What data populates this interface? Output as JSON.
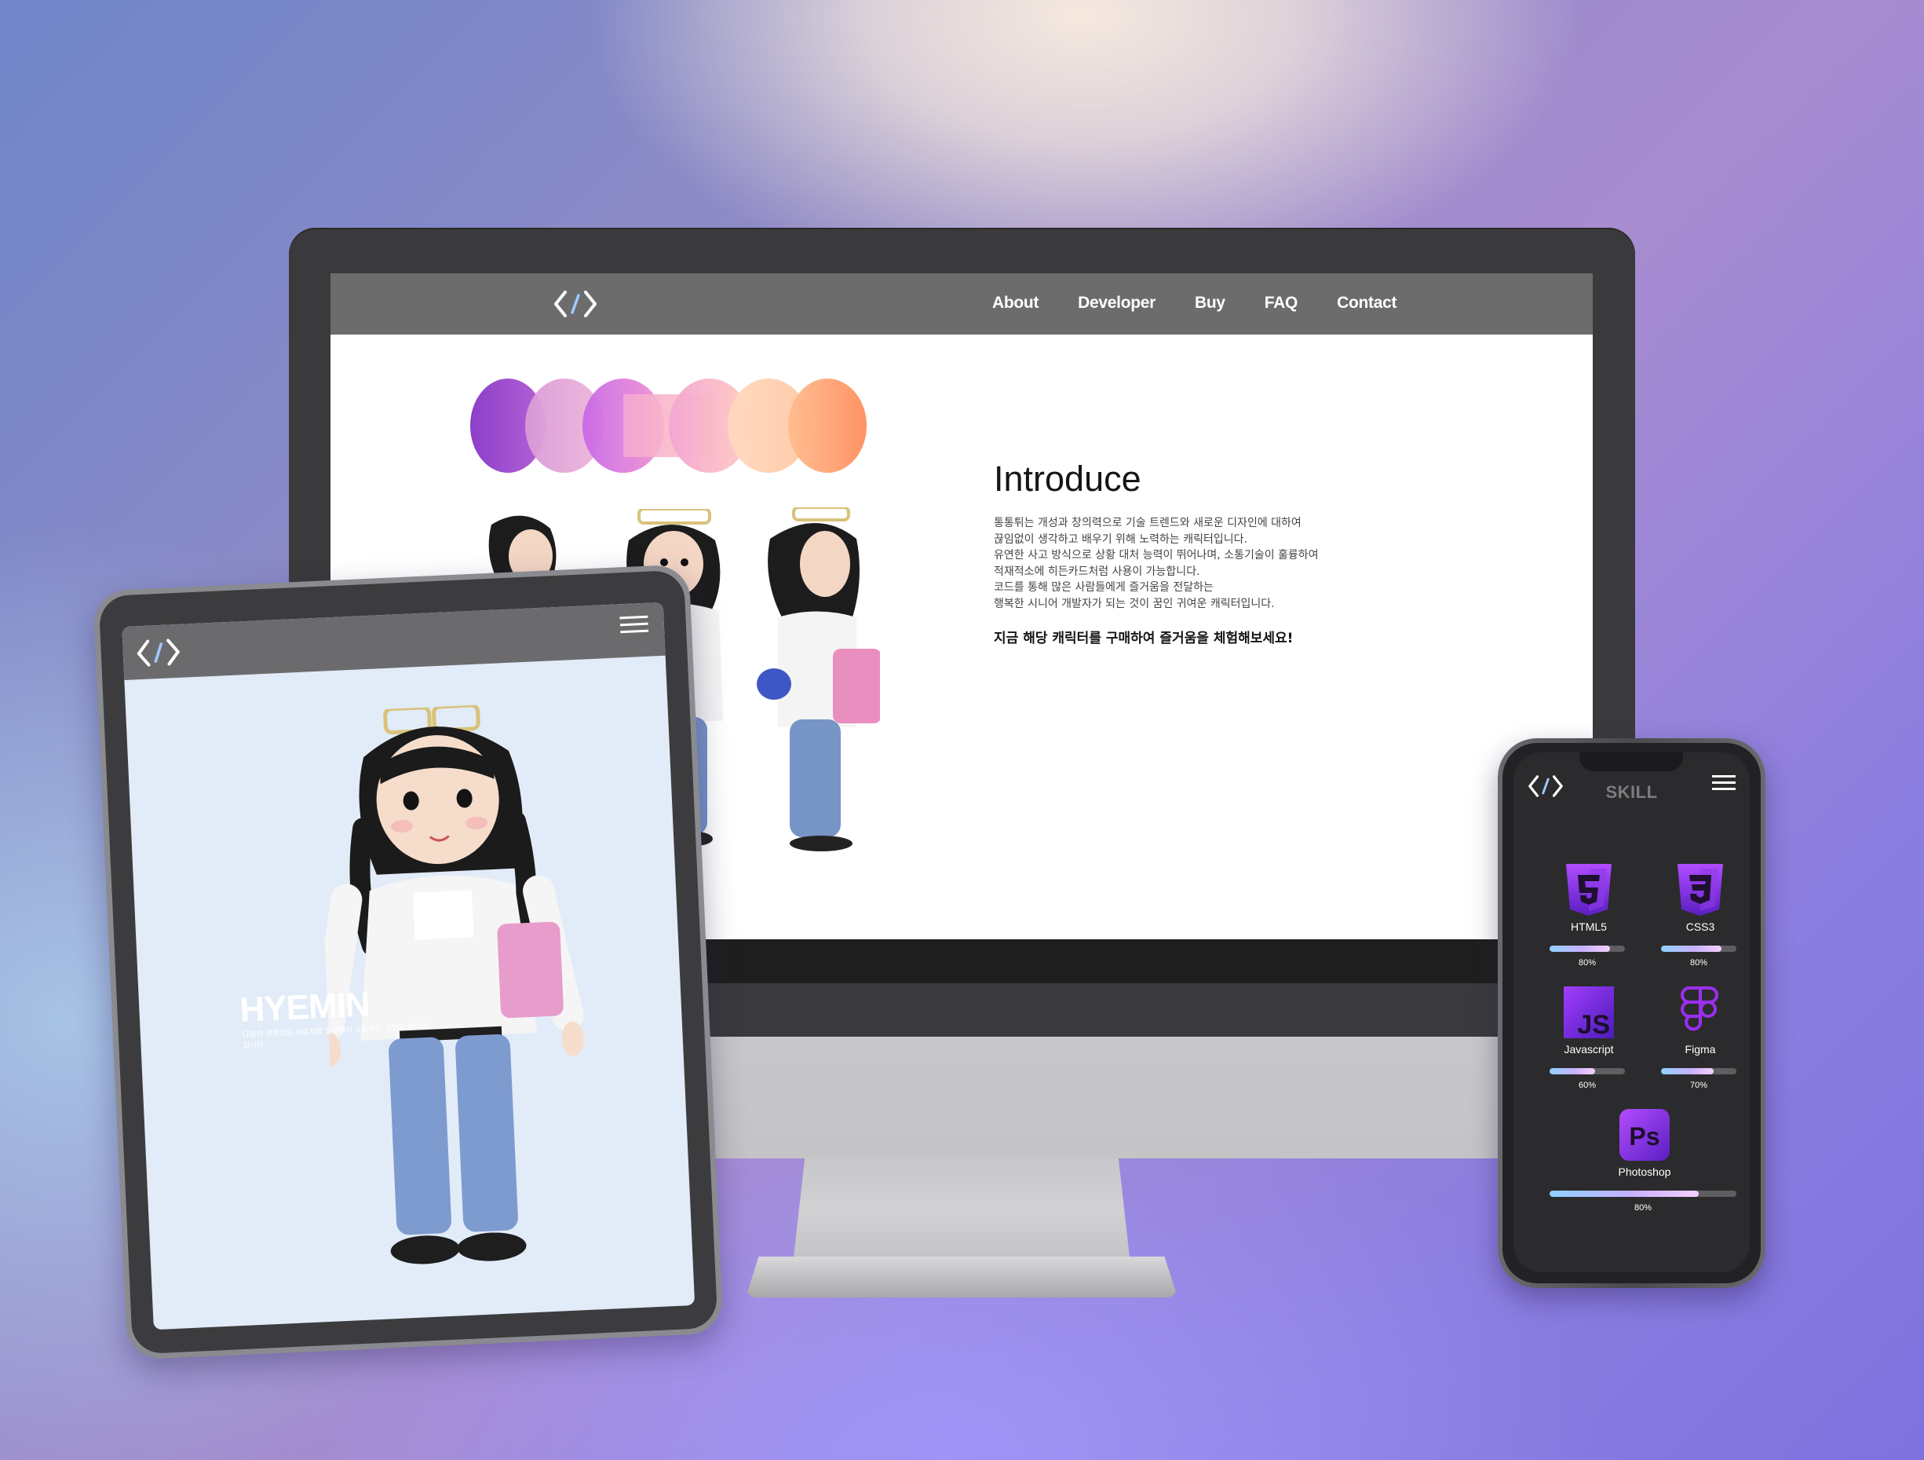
{
  "desktop": {
    "nav": {
      "logo_icon": "code-brackets-icon",
      "items": [
        "About",
        "Developer",
        "Buy",
        "FAQ",
        "Contact"
      ]
    },
    "intro": {
      "title": "Introduce",
      "body_lines": [
        "통통튀는 개성과 창의력으로 기술 트렌드와 새로운 디자인에 대하여",
        "끊임없이 생각하고 배우기 위해 노력하는 캐릭터입니다.",
        "유연한 사고 방식으로 상황 대처 능력이 뛰어나며, 소통기술이 훌륭하여",
        "적재적소에 히든카드처럼 사용이 가능합니다.",
        "코드를 통해 많은 사람들에게 즐거움을 전달하는",
        "행복한 시니어 개발자가 되는 것이 꿈인 귀여운 캐릭터입니다."
      ],
      "cta": "지금 해당 캐릭터를 구매하여 즐거움을 체험해보세요!"
    }
  },
  "tablet": {
    "logo_icon": "code-brackets-icon",
    "menu_icon": "hamburger-menu-icon",
    "hero_title": "HYEMIN",
    "hero_sub": "다양한 경험으로 사람처럼 일잘해서 소통하는 개발자 캐릭터입니다."
  },
  "phone": {
    "logo_icon": "code-brackets-icon",
    "menu_icon": "hamburger-menu-icon",
    "title": "SKILL",
    "skills": [
      {
        "name": "HTML5",
        "icon": "html5-icon",
        "percent": 80,
        "label": "80%"
      },
      {
        "name": "CSS3",
        "icon": "css3-icon",
        "percent": 80,
        "label": "80%"
      },
      {
        "name": "Javascript",
        "icon": "javascript-icon",
        "percent": 60,
        "label": "60%"
      },
      {
        "name": "Figma",
        "icon": "figma-icon",
        "percent": 70,
        "label": "70%"
      },
      {
        "name": "Photoshop",
        "icon": "photoshop-icon",
        "percent": 80,
        "label": "80%"
      }
    ]
  },
  "colors": {
    "nav_gray": "#6c6c6d",
    "skill_icon_purple": "#7b2fd8",
    "progress_gradient": [
      "#8fd2ff",
      "#c7b0ff",
      "#f4d0ff"
    ],
    "blob_gradient": [
      "#9b4fd0",
      "#e9a3d6",
      "#d479e8",
      "#ffd3b0",
      "#ff9a6a"
    ]
  }
}
